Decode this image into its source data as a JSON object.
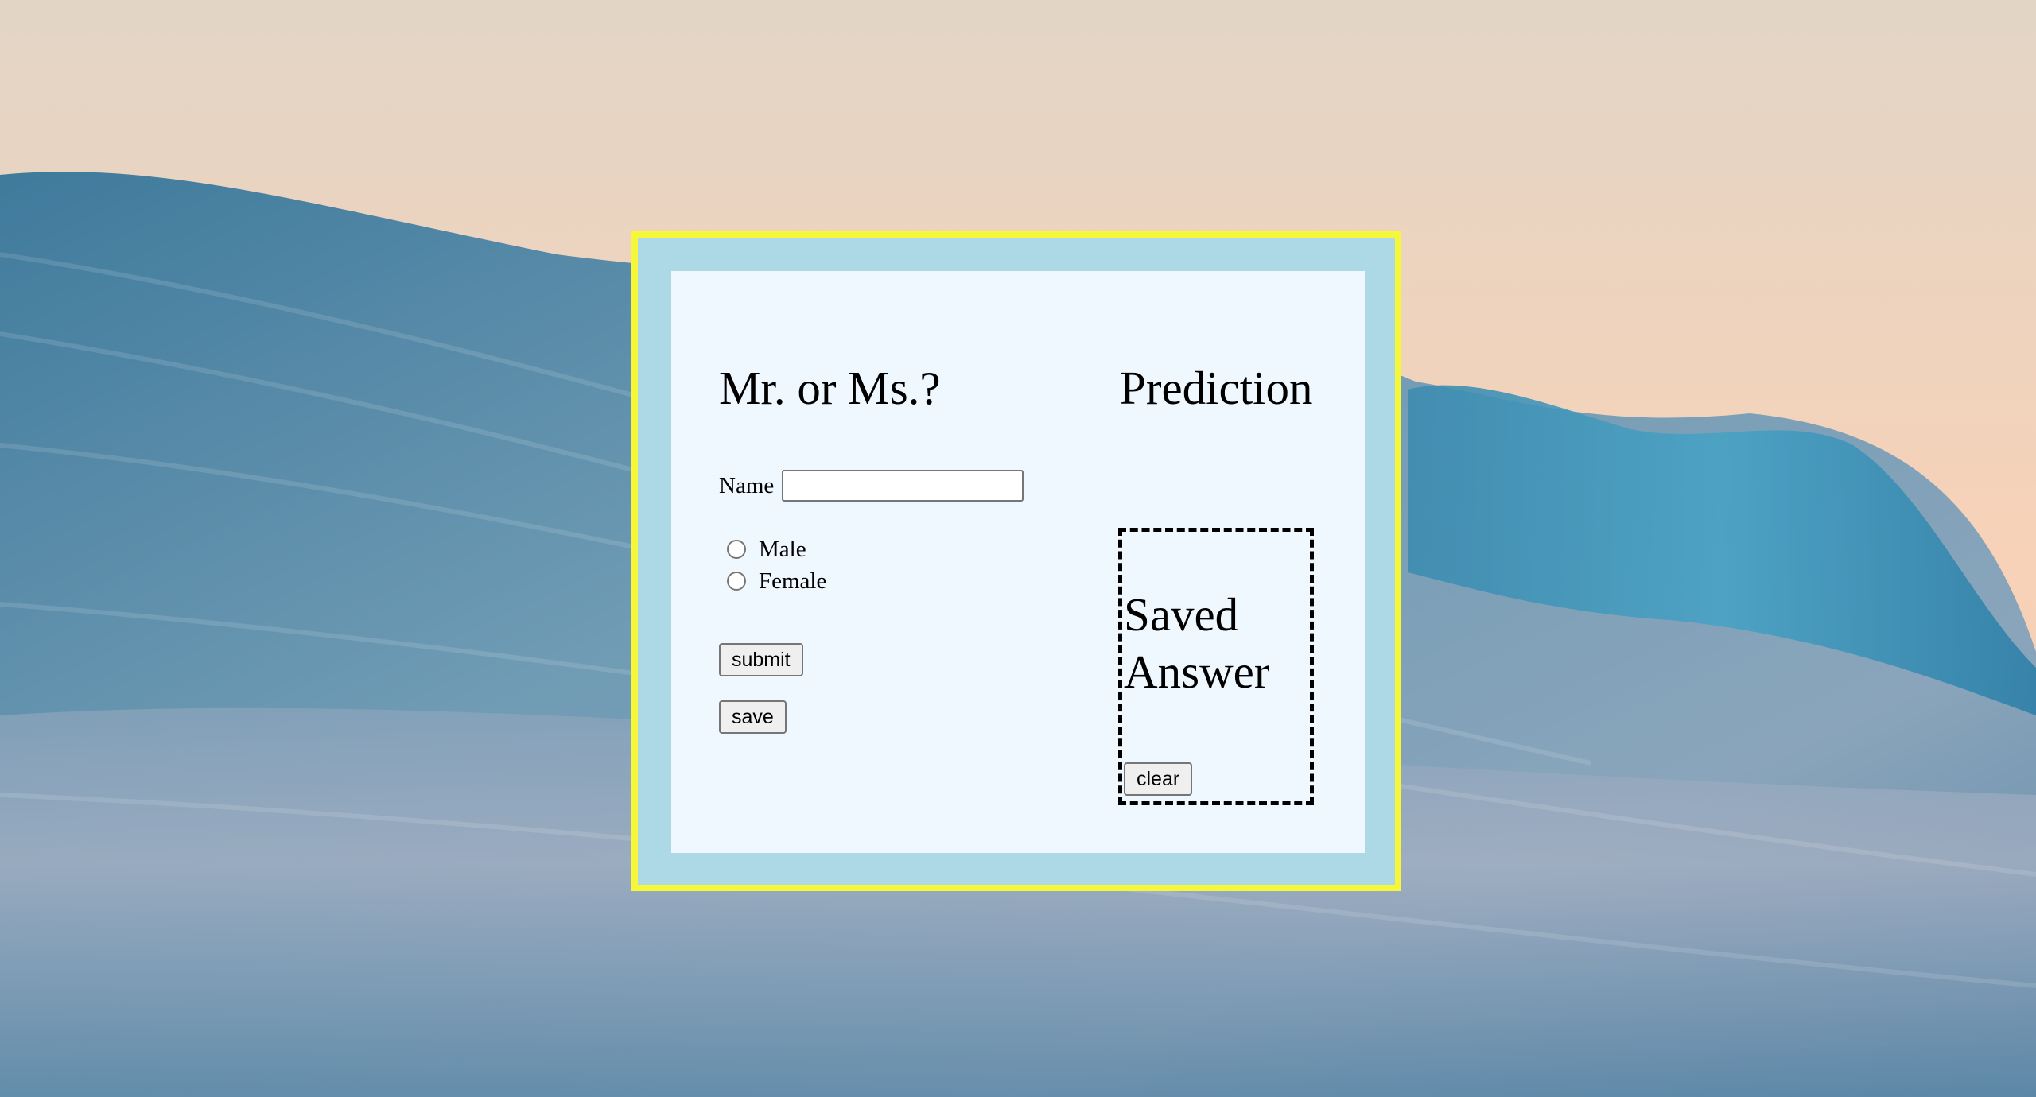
{
  "form": {
    "title": "Mr. or Ms.?",
    "name_label": "Name",
    "name_value": "",
    "gender_options": [
      {
        "label": "Male",
        "checked": false
      },
      {
        "label": "Female",
        "checked": false
      }
    ],
    "submit_label": "submit",
    "save_label": "save"
  },
  "prediction": {
    "title": "Prediction",
    "saved_answer_text": "Saved Answer",
    "clear_label": "clear"
  },
  "colors": {
    "frame_border": "#f7f73a",
    "frame_fill": "#add8e6",
    "card_fill": "#f0f8ff"
  },
  "background": {
    "icon": "ocean-wave-image"
  }
}
